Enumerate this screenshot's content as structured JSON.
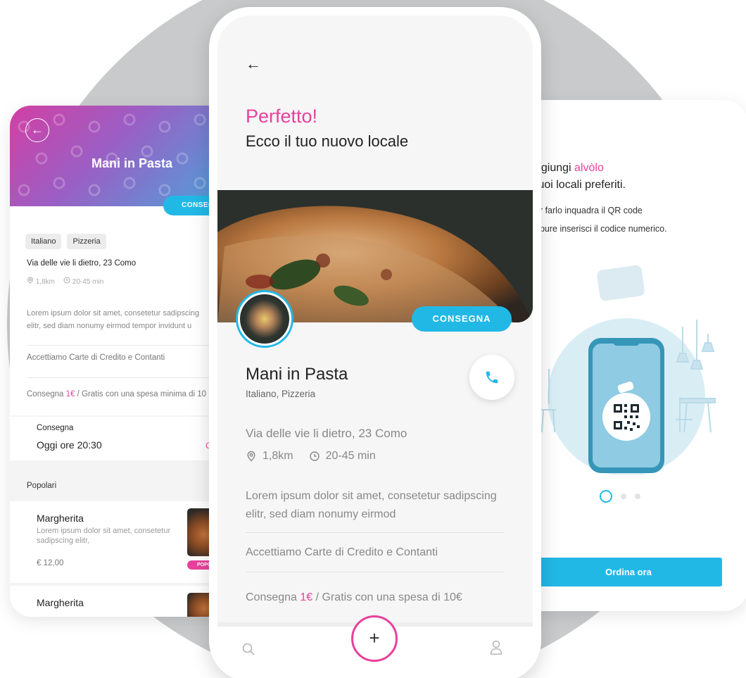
{
  "left_screen": {
    "title": "Mani in Pasta",
    "delivery_pill": "CONSEGNA",
    "tags": [
      "Italiano",
      "Pizzeria"
    ],
    "address": "Via delle vie li dietro, 23 Como",
    "distance": "1,8km",
    "time_range": "20-45 min",
    "description_line1": "Lorem ipsum dolor sit amet, consetetur sadipscing",
    "description_line2": "elitr, sed diam nonumy eirmod tempor invidunt u",
    "payments": "Accettiamo Carte di Credito e Contanti",
    "delivery_prefix": "Consegna ",
    "delivery_price": "1€",
    "delivery_suffix": " / Gratis con una spesa minima di 10",
    "consegna_label": "Consegna",
    "consegna_time": "Oggi  ore 20:30",
    "change_link": "Cam",
    "popular_heading": "Popolari",
    "items": [
      {
        "title": "Margherita",
        "desc": "Lorem ipsum dolor sit amet, consetetur sadipscing elitr,",
        "price": "€ 12,00",
        "badge": "POPO"
      },
      {
        "title": "Margherita"
      }
    ]
  },
  "center_screen": {
    "title": "Perfetto!",
    "subtitle": "Ecco il tuo nuovo locale",
    "delivery_pill": "CONSEGNA",
    "name": "Mani in Pasta",
    "cuisine": "Italiano, Pizzeria",
    "address": "Via delle vie li dietro, 23 Como",
    "distance": "1,8km",
    "time_range": "20-45 min",
    "description": "Lorem ipsum dolor sit amet, consetetur sadipscing elitr, sed diam nonumy eirmod",
    "payments": "Accettiamo Carte di Credito e Contanti",
    "delivery_prefix": "Consegna ",
    "delivery_price": "1€",
    "delivery_suffix": " / Gratis con una spesa di 10€",
    "fab_label": "+"
  },
  "right_screen": {
    "line1_prefix": "ggiungi ",
    "line1_brand": "alvòlo",
    "line2": "tuoi locali preferiti.",
    "sub1": "er farlo inquadra il QR code",
    "sub2": "opure inserisci il codice numerico.",
    "cta": "Ordina ora",
    "page_count": 3,
    "active_page": 1
  },
  "colors": {
    "accent_pink": "#e8419c",
    "accent_blue": "#22b8e6"
  }
}
